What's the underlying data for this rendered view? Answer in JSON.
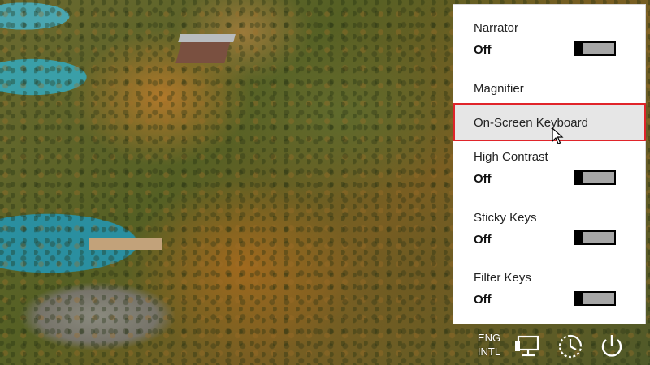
{
  "accessibility_panel": {
    "items": [
      {
        "label": "Narrator",
        "state": "Off"
      },
      {
        "label": "Magnifier"
      },
      {
        "label": "On-Screen Keyboard"
      },
      {
        "label": "High Contrast",
        "state": "Off"
      },
      {
        "label": "Sticky Keys",
        "state": "Off"
      },
      {
        "label": "Filter Keys",
        "state": "Off"
      }
    ],
    "highlight_color": "#e0242a"
  },
  "tray": {
    "language_line1": "ENG",
    "language_line2": "INTL",
    "icons": [
      "network-icon",
      "ease-of-access-icon",
      "power-icon"
    ]
  }
}
